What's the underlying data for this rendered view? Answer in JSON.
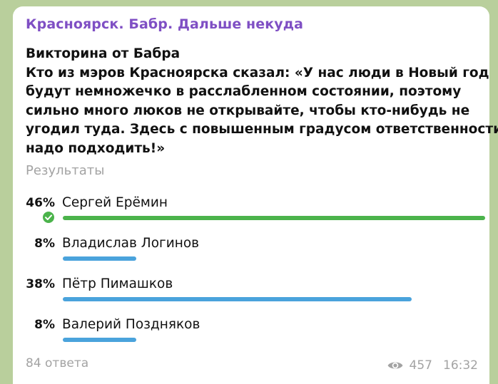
{
  "message": {
    "channel_name": "Красноярск. Бабр. Дальше некуда",
    "question_lines": [
      "Викторина от Бабра",
      "Кто из мэров Красноярска сказал: «У нас люди в Новый год",
      "будут немножечко в расслабленном состоянии, поэтому",
      "сильно много люков не открывайте, чтобы кто-нибудь не",
      "угодил туда. Здесь с повышенным градусом ответственности",
      "надо подходить!»"
    ],
    "results_label": "Результаты",
    "answers_count": "84 ответа",
    "views": "457",
    "time": "16:32"
  },
  "poll": {
    "options": [
      {
        "percent_label": "46%",
        "text": "Сергей Ерёмин",
        "percent": 46,
        "correct": true
      },
      {
        "percent_label": "8%",
        "text": "Владислав Логинов",
        "percent": 8,
        "correct": false
      },
      {
        "percent_label": "38%",
        "text": "Пётр Пимашков",
        "percent": 38,
        "correct": false
      },
      {
        "percent_label": "8%",
        "text": "Валерий Поздняков",
        "percent": 8,
        "correct": false
      }
    ]
  },
  "colors": {
    "channel_name": "#7f4fc4",
    "bar_default": "#4aa3dc",
    "bar_correct": "#4bb34b",
    "muted_text": "#a3a3a3",
    "chat_background": "#b9cf9c"
  }
}
